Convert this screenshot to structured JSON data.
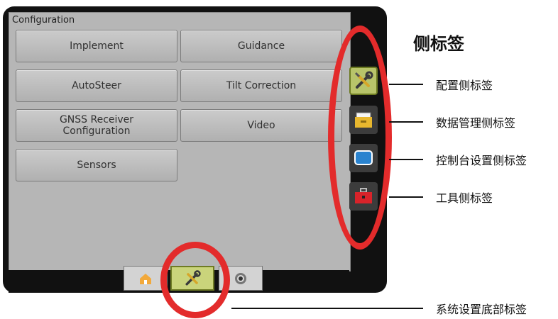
{
  "panel": {
    "title": "Configuration",
    "buttons": [
      {
        "label": "Implement"
      },
      {
        "label": "Guidance"
      },
      {
        "label": "AutoSteer"
      },
      {
        "label": "Tilt Correction"
      },
      {
        "label": "GNSS Receiver Configuration"
      },
      {
        "label": "Video"
      },
      {
        "label": "Sensors"
      }
    ]
  },
  "side_tabs": [
    {
      "icon": "wrench-screwdriver-icon",
      "active": true
    },
    {
      "icon": "file-drawer-icon",
      "active": false
    },
    {
      "icon": "console-screen-icon",
      "active": false
    },
    {
      "icon": "toolbox-icon",
      "active": false
    }
  ],
  "bottom_tabs": [
    {
      "icon": "home-icon",
      "active": false
    },
    {
      "icon": "wrench-screwdriver-icon",
      "active": true
    },
    {
      "icon": "camera-icon",
      "active": false
    }
  ],
  "annotations": {
    "heading": "侧标签",
    "config_side_tab": "配置侧标签",
    "data_mgmt_side_tab": "数据管理侧标签",
    "console_settings_side_tab": "控制台设置侧标签",
    "tools_side_tab": "工具侧标签",
    "system_setup_bottom_tab": "系统设置底部标签"
  },
  "colors": {
    "highlight": "#e32b2b",
    "active_tab": "#b8c46a",
    "panel_bg": "#b6b6b6",
    "frame": "#111111"
  }
}
